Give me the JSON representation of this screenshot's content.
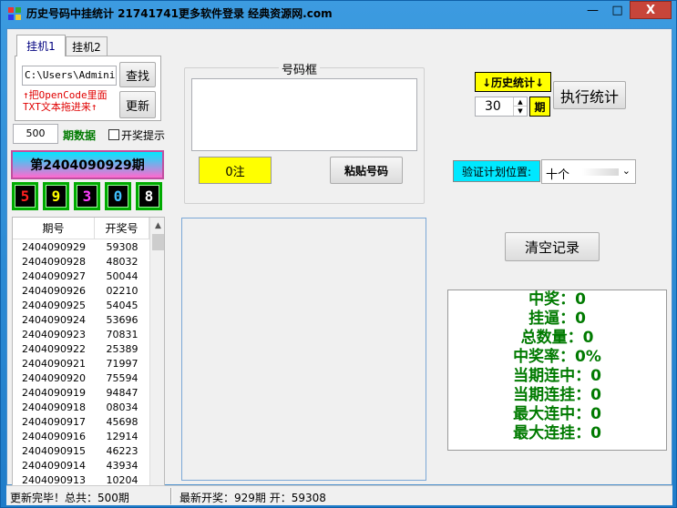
{
  "window": {
    "title": "历史号码中挂统计  21741741更多软件登录 经典资源网.com",
    "close_glyph": "X",
    "min_glyph": "—",
    "max_glyph": "□"
  },
  "tabs": [
    {
      "label": "挂机1"
    },
    {
      "label": "挂机2"
    }
  ],
  "file": {
    "path_value": "C:\\Users\\Administ",
    "find_button": "查找",
    "update_button": "更新",
    "hint_line1": "↑把OpenCode里面",
    "hint_line2": "TXT文本拖进来↑"
  },
  "data_count": {
    "value": "500",
    "label": "期数据"
  },
  "draw_hint": {
    "label": "开奖提示",
    "checked": false
  },
  "current_period": {
    "label": "第2404090929期",
    "digits": [
      {
        "value": "5",
        "color": "#ff2020"
      },
      {
        "value": "9",
        "color": "#ffff00"
      },
      {
        "value": "3",
        "color": "#ff40ff"
      },
      {
        "value": "0",
        "color": "#40c0ff"
      },
      {
        "value": "8",
        "color": "#ffffff"
      }
    ]
  },
  "history_table": {
    "headers": [
      "期号",
      "开奖号"
    ],
    "rows": [
      [
        "2404090929",
        "59308"
      ],
      [
        "2404090928",
        "48032"
      ],
      [
        "2404090927",
        "50044"
      ],
      [
        "2404090926",
        "02210"
      ],
      [
        "2404090925",
        "54045"
      ],
      [
        "2404090924",
        "53696"
      ],
      [
        "2404090923",
        "70831"
      ],
      [
        "2404090922",
        "25389"
      ],
      [
        "2404090921",
        "71997"
      ],
      [
        "2404090920",
        "75594"
      ],
      [
        "2404090919",
        "94847"
      ],
      [
        "2404090918",
        "08034"
      ],
      [
        "2404090917",
        "45698"
      ],
      [
        "2404090916",
        "12914"
      ],
      [
        "2404090915",
        "46223"
      ],
      [
        "2404090914",
        "43934"
      ],
      [
        "2404090913",
        "10204"
      ]
    ]
  },
  "number_box": {
    "title": "号码框",
    "count_label": "0注",
    "paste_button": "粘贴号码"
  },
  "history_stats": {
    "button": "↓历史统计↓",
    "periods_value": "30",
    "periods_unit": "期",
    "execute_button": "执行统计"
  },
  "verify": {
    "label": "验证计划位置:",
    "selected": "十个"
  },
  "clear_button": "清空记录",
  "results": [
    "中奖：0",
    "挂逼：0",
    "总数量：0",
    "中奖率：0%",
    "当期连中：0",
    "当期连挂：0",
    "最大连中：0",
    "最大连挂：0"
  ],
  "status": {
    "left": "更新完毕！总共：500期",
    "right": "最新开奖：929期 开：59308"
  }
}
